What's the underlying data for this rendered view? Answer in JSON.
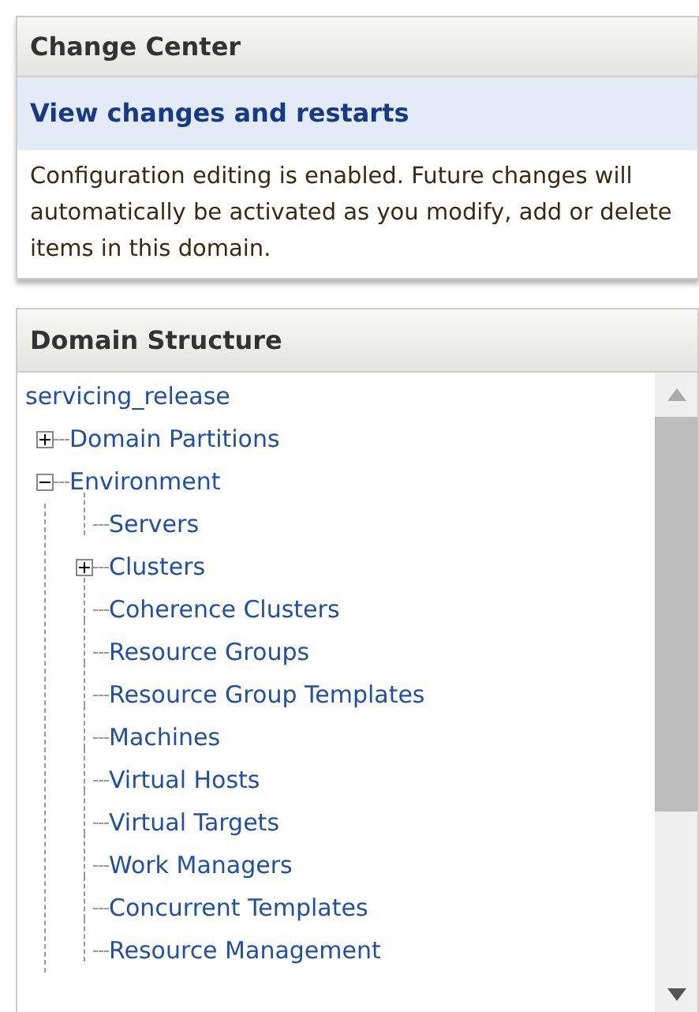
{
  "change_center": {
    "title": "Change Center",
    "link": "View changes and restarts",
    "message": "Configuration editing is enabled. Future changes will automatically be activated as you modify, add or delete items in this domain."
  },
  "domain_structure": {
    "title": "Domain Structure",
    "tree": {
      "label": "servicing_release",
      "children": [
        {
          "label": "Domain Partitions",
          "expanded": false
        },
        {
          "label": "Environment",
          "expanded": true,
          "children": [
            {
              "label": "Servers"
            },
            {
              "label": "Clusters",
              "expanded": false
            },
            {
              "label": "Coherence Clusters"
            },
            {
              "label": "Resource Groups"
            },
            {
              "label": "Resource Group Templates"
            },
            {
              "label": "Machines"
            },
            {
              "label": "Virtual Hosts"
            },
            {
              "label": "Virtual Targets"
            },
            {
              "label": "Work Managers"
            },
            {
              "label": "Concurrent Templates"
            },
            {
              "label": "Resource Management"
            }
          ]
        }
      ]
    }
  }
}
